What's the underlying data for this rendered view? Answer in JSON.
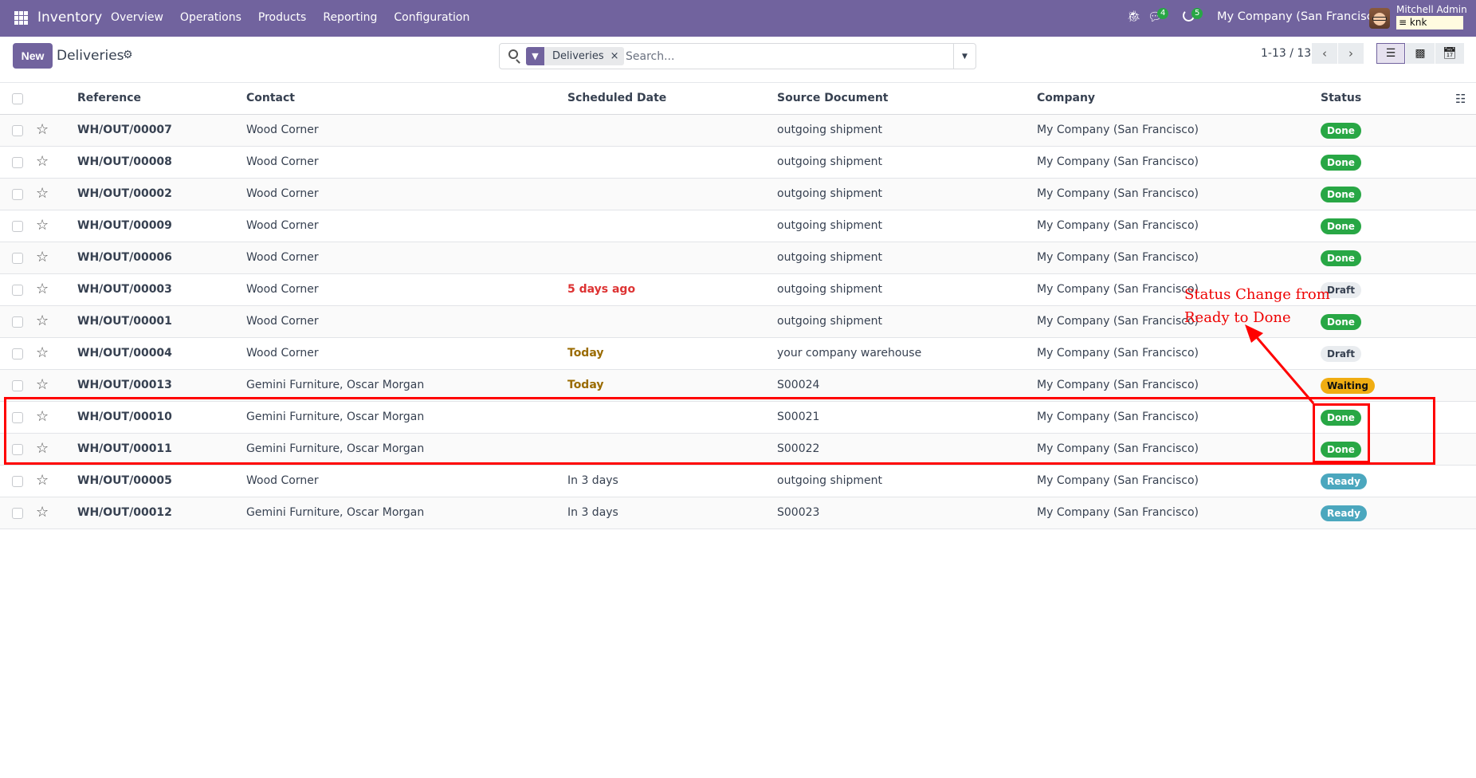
{
  "navbar": {
    "app_name": "Inventory",
    "menu": [
      "Overview",
      "Operations",
      "Products",
      "Reporting",
      "Configuration"
    ],
    "messages_count": "4",
    "activities_count": "5",
    "company": "My Company (San Francisco)",
    "user_name": "Mitchell Admin",
    "database": "knk"
  },
  "control_panel": {
    "new_label": "New",
    "title": "Deliveries",
    "search": {
      "facet_label": "Deliveries",
      "facet_remove": "×",
      "placeholder": "Search...",
      "value": ""
    },
    "pager": "1-13 / 13",
    "views": [
      "list",
      "kanban",
      "calendar"
    ],
    "active_view": "list"
  },
  "table": {
    "columns": [
      "Reference",
      "Contact",
      "Scheduled Date",
      "Source Document",
      "Company",
      "Status"
    ],
    "rows": [
      {
        "reference": "WH/OUT/00007",
        "contact": "Wood Corner",
        "scheduled": "",
        "scheduled_style": "",
        "source": "outgoing shipment",
        "company": "My Company (San Francisco)",
        "status": "Done",
        "status_type": "done"
      },
      {
        "reference": "WH/OUT/00008",
        "contact": "Wood Corner",
        "scheduled": "",
        "scheduled_style": "",
        "source": "outgoing shipment",
        "company": "My Company (San Francisco)",
        "status": "Done",
        "status_type": "done"
      },
      {
        "reference": "WH/OUT/00002",
        "contact": "Wood Corner",
        "scheduled": "",
        "scheduled_style": "",
        "source": "outgoing shipment",
        "company": "My Company (San Francisco)",
        "status": "Done",
        "status_type": "done"
      },
      {
        "reference": "WH/OUT/00009",
        "contact": "Wood Corner",
        "scheduled": "",
        "scheduled_style": "",
        "source": "outgoing shipment",
        "company": "My Company (San Francisco)",
        "status": "Done",
        "status_type": "done"
      },
      {
        "reference": "WH/OUT/00006",
        "contact": "Wood Corner",
        "scheduled": "",
        "scheduled_style": "",
        "source": "outgoing shipment",
        "company": "My Company (San Francisco)",
        "status": "Done",
        "status_type": "done"
      },
      {
        "reference": "WH/OUT/00003",
        "contact": "Wood Corner",
        "scheduled": "5 days ago",
        "scheduled_style": "late",
        "source": "outgoing shipment",
        "company": "My Company (San Francisco)",
        "status": "Draft",
        "status_type": "draft"
      },
      {
        "reference": "WH/OUT/00001",
        "contact": "Wood Corner",
        "scheduled": "",
        "scheduled_style": "",
        "source": "outgoing shipment",
        "company": "My Company (San Francisco)",
        "status": "Done",
        "status_type": "done"
      },
      {
        "reference": "WH/OUT/00004",
        "contact": "Wood Corner",
        "scheduled": "Today",
        "scheduled_style": "today",
        "source": "your company warehouse",
        "company": "My Company (San Francisco)",
        "status": "Draft",
        "status_type": "draft"
      },
      {
        "reference": "WH/OUT/00013",
        "contact": "Gemini Furniture, Oscar Morgan",
        "scheduled": "Today",
        "scheduled_style": "today",
        "source": "S00024",
        "company": "My Company (San Francisco)",
        "status": "Waiting",
        "status_type": "waiting"
      },
      {
        "reference": "WH/OUT/00010",
        "contact": "Gemini Furniture, Oscar Morgan",
        "scheduled": "",
        "scheduled_style": "",
        "source": "S00021",
        "company": "My Company (San Francisco)",
        "status": "Done",
        "status_type": "done"
      },
      {
        "reference": "WH/OUT/00011",
        "contact": "Gemini Furniture, Oscar Morgan",
        "scheduled": "",
        "scheduled_style": "",
        "source": "S00022",
        "company": "My Company (San Francisco)",
        "status": "Done",
        "status_type": "done"
      },
      {
        "reference": "WH/OUT/00005",
        "contact": "Wood Corner",
        "scheduled": "In 3 days",
        "scheduled_style": "",
        "source": "outgoing shipment",
        "company": "My Company (San Francisco)",
        "status": "Ready",
        "status_type": "ready"
      },
      {
        "reference": "WH/OUT/00012",
        "contact": "Gemini Furniture, Oscar Morgan",
        "scheduled": "In 3 days",
        "scheduled_style": "",
        "source": "S00023",
        "company": "My Company (San Francisco)",
        "status": "Ready",
        "status_type": "ready"
      }
    ]
  },
  "annotation": {
    "line1": "Status Change from",
    "line2": "Ready to Done",
    "color": "#ff0000"
  },
  "colors": {
    "brand": "#71639e",
    "done": "#28a745",
    "ready": "#4ba7be",
    "waiting": "#f0ad12",
    "draft": "#e9ecef"
  }
}
